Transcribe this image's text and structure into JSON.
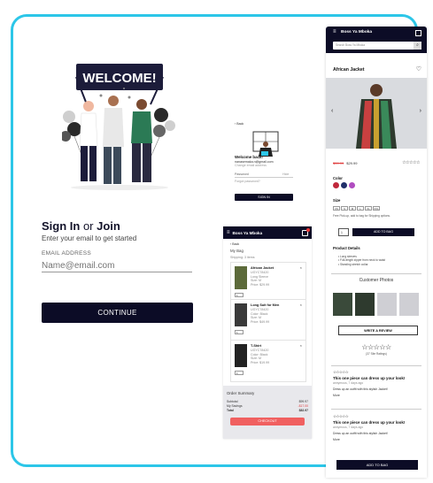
{
  "signin": {
    "title_a": "Sign In",
    "title_or": " or ",
    "title_b": "Join",
    "subtitle": "Enter your email to get started",
    "email_label": "EMAIL ADDRESS",
    "email_placeholder": "Name@email.com",
    "continue_label": "CONTINUE",
    "banner_text": "WELCOME!"
  },
  "mini_login": {
    "back": "‹ Back",
    "welcome": "Welcome back!",
    "email": "nanasemaka.n@gmail.com",
    "change": "Change email address",
    "password_label": "Password",
    "hide": "Hide",
    "forgot": "Forgot password?",
    "signin_button": "SIGN IN"
  },
  "bag": {
    "brand": "Boss Ya Mboka",
    "back": "‹ Back",
    "title": "My Bag",
    "shipping_note": "Shipping: 3 items",
    "items": [
      {
        "name": "African Jacket",
        "meta": [
          "UGYC78420",
          "Long Sleeve",
          "Size: M",
          "Price: $29.99"
        ],
        "qty": "1"
      },
      {
        "name": "Long Suit for Men",
        "meta": [
          "UGYC78420",
          "Color: Black",
          "Size: M",
          "Price: $49.99"
        ],
        "qty": "1"
      },
      {
        "name": "T-Shirt",
        "meta": [
          "UGYC78420",
          "Color: Black",
          "Size: M",
          "Price: $19.99"
        ],
        "qty": "1"
      }
    ],
    "summary_title": "Order Summary",
    "summary_rows": [
      {
        "label": "Subtotal",
        "value": "$99.97"
      },
      {
        "label": "My Savings",
        "value": "-$17.00"
      },
      {
        "label": "Total",
        "value": "$82.97"
      }
    ],
    "checkout": "CHECKOUT"
  },
  "product": {
    "brand": "Boss Ya Mboka",
    "search_placeholder": "Search Boss Ya Mboka",
    "title": "African Jacket",
    "old_price": "$39.99",
    "price": "$29.99",
    "stars": "☆☆☆☆☆",
    "color_label": "Color",
    "size_label": "Size",
    "sizes": [
      "XS",
      "S",
      "M",
      "L",
      "XL",
      "XXL"
    ],
    "pickup": "Free Pick-up, add to bag for Shipping options.",
    "qty": "1",
    "add_to_bag": "ADD TO BAG",
    "details_label": "Product Details",
    "details": [
      "• Long sleeves",
      "• Full-length zipper from neck to waist",
      "• Standing stretch collar"
    ],
    "customer_photos": "Customer Photos",
    "write_review": "WRITE A REVIEW",
    "big_stars": "☆☆☆☆☆",
    "rating_count": "(37 Site Ratings)",
    "reviews": [
      {
        "stars": "☆☆☆☆☆",
        "title": "This one piece can dress up your look!",
        "author": "annymous, 7 days ago",
        "body": "Dress up an outfit with this stylish Jacket!",
        "more": "More"
      },
      {
        "stars": "☆☆☆☆☆",
        "title": "This one piece can dress up your look!",
        "author": "annymous, 7 days ago",
        "body": "Dress up an outfit with this stylish Jacket!",
        "more": "More"
      }
    ],
    "bottom_button": "ADD TO BAG"
  },
  "colors": {
    "accent": "#2cc6e8",
    "navy": "#0c0c26",
    "checkout": "#f06060",
    "swatch_1": "#c0283c",
    "swatch_2": "#20306a",
    "swatch_3": "#b04cc0"
  }
}
